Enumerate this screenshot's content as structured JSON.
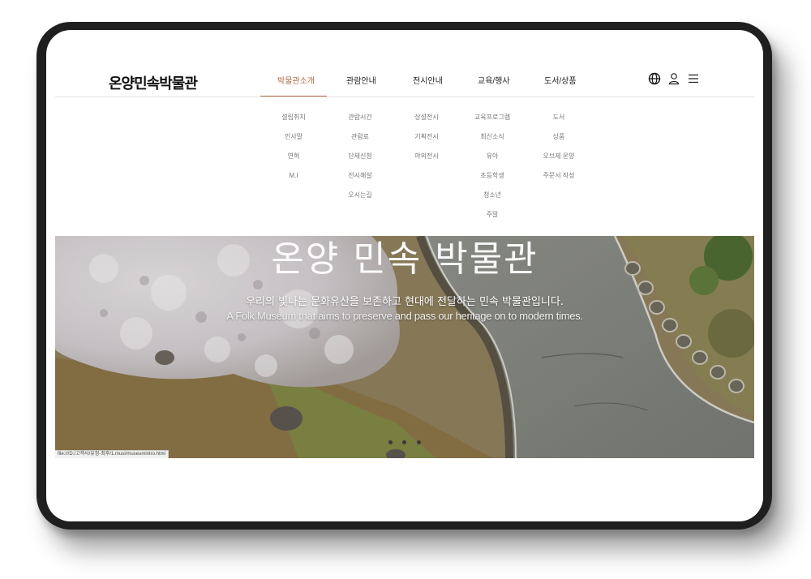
{
  "site": {
    "logo_text": "온양민속박물관"
  },
  "nav": {
    "items": [
      {
        "label": "박물관소개"
      },
      {
        "label": "관람안내"
      },
      {
        "label": "전시안내"
      },
      {
        "label": "교육/행사"
      },
      {
        "label": "도서/상품"
      }
    ],
    "active_color": "#b86b47"
  },
  "header_icons": [
    "globe-icon",
    "user-icon",
    "menu-icon"
  ],
  "submenus": [
    [
      "설립취지",
      "인사말",
      "연혁",
      "M.I"
    ],
    [
      "관람시간",
      "관람료",
      "단체신청",
      "전시해설",
      "오시는길"
    ],
    [
      "상설전시",
      "기획전시",
      "야외전시"
    ],
    [
      "교육프로그램",
      "최신소식",
      "유아",
      "초등학생",
      "청소년",
      "주말"
    ],
    [
      "도서",
      "상품",
      "오브제 온양",
      "주문서 작성"
    ]
  ],
  "hero": {
    "title": "온양 민속 박물관",
    "subtitle_ko": "우리의 빛나는 문화유산을 보존하고 현대에 전달하는 민속 박물관입니다.",
    "subtitle_en": "A Folk Museum that aims to preserve and pass our heritage on to modern times.",
    "slide_count": 3
  },
  "status_bar": {
    "url": "file:///D:/고객사/유정-최후/1.musi/museumintro.html"
  }
}
